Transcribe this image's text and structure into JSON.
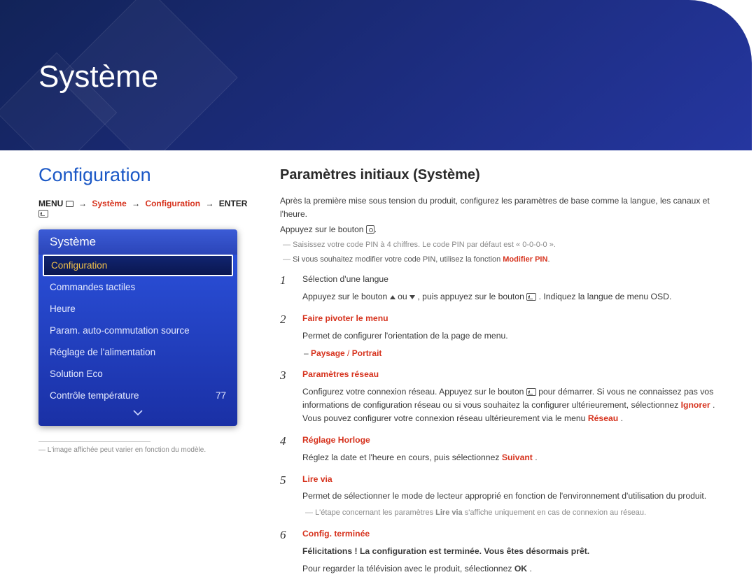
{
  "banner": {
    "title": "Système"
  },
  "left": {
    "heading": "Configuration",
    "path_menu": "MENU",
    "path_systeme": "Système",
    "path_config": "Configuration",
    "path_enter": "ENTER",
    "footnote": "L'image affichée peut varier en fonction du modèle."
  },
  "osd": {
    "title": "Système",
    "items": [
      {
        "label": "Configuration",
        "selected": true
      },
      {
        "label": "Commandes tactiles"
      },
      {
        "label": "Heure"
      },
      {
        "label": "Param. auto-commutation source"
      },
      {
        "label": "Réglage de l'alimentation"
      },
      {
        "label": "Solution Eco"
      },
      {
        "label": "Contrôle température",
        "value": "77"
      }
    ]
  },
  "right": {
    "heading": "Paramètres initiaux (Système)",
    "intro1": "Après la première mise sous tension du produit, configurez les paramètres de base comme la langue, les canaux et l'heure.",
    "intro2_prefix": "Appuyez sur le bouton ",
    "intro2_suffix": ".",
    "note1": "Saisissez votre code PIN à 4 chiffres. Le code PIN par défaut est « 0-0-0-0 ».",
    "note2_prefix": "Si vous souhaitez modifier votre code PIN, utilisez la fonction ",
    "note2_red": "Modifier PIN",
    "note2_suffix": ".",
    "steps": {
      "s1": {
        "title": "Sélection d'une langue",
        "body_pre": "Appuyez sur le bouton ",
        "body_mid": " ou ",
        "body_post1": ", puis appuyez sur le bouton ",
        "body_post2": ". Indiquez la langue de menu OSD."
      },
      "s2": {
        "title": "Faire pivoter le menu",
        "body": "Permet de configurer l'orientation de la page de menu.",
        "opt_a": "Paysage",
        "opt_sep": " / ",
        "opt_b": "Portrait"
      },
      "s3": {
        "title": "Paramètres réseau",
        "body_pre": "Configurez votre connexion réseau. Appuyez sur le bouton ",
        "body_mid1": " pour démarrer. Si vous ne connaissez pas vos informations de configuration réseau ou si vous souhaitez la configurer ultérieurement, sélectionnez ",
        "body_ignorer": "Ignorer",
        "body_mid2": ". Vous pouvez configurer votre connexion réseau ultérieurement via le menu ",
        "body_reseau": "Réseau",
        "body_end": "."
      },
      "s4": {
        "title": "Réglage Horloge",
        "body_pre": "Réglez la date et l'heure en cours, puis sélectionnez ",
        "body_suivant": "Suivant",
        "body_end": "."
      },
      "s5": {
        "title": "Lire via",
        "body": "Permet de sélectionner le mode de lecteur approprié en fonction de l'environnement d'utilisation du produit.",
        "note_pre": "L'étape concernant les paramètres ",
        "note_red": "Lire via",
        "note_post": " s'affiche uniquement en cas de connexion au réseau."
      },
      "s6": {
        "title": "Config. terminée",
        "congrats": "Félicitations ! La configuration est terminée. Vous êtes désormais prêt.",
        "body_pre": "Pour regarder la télévision avec le produit, sélectionnez ",
        "body_ok": "OK",
        "body_end": "."
      }
    }
  }
}
